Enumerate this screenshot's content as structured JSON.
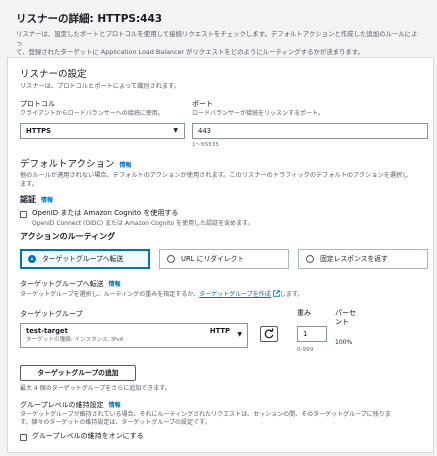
{
  "header": {
    "title": "リスナーの詳細: HTTPS:443",
    "desc_line1": "リスナーは、設定したポートとプロトコルを使用して接続リクエストをチェックします。デフォルトアクションと作成した追加のルールによっ",
    "desc_line2": "て、登録されたターゲットに Application Load Balancer がリクエストをどのようにルーティングするかが決まります。"
  },
  "listener_settings": {
    "title": "リスナーの設定",
    "desc": "リスナーは、プロトコルとポートによって識別されます。",
    "protocol_label": "プロトコル",
    "protocol_desc": "クライアントからロードバランサーへの接続に使用。",
    "protocol_value": "HTTPS",
    "port_label": "ポート",
    "port_desc": "ロードバランサーが接続をリッスンするポート。",
    "port_value": "443",
    "port_hint": "1〜65535"
  },
  "default_actions": {
    "title": "デフォルトアクション",
    "info": "情報",
    "desc": "他のルールが適用されない場合、デフォルトのアクションが使用されます。このリスナーのトラフィックのデフォルトのアクションを選択し",
    "desc2": "ます。"
  },
  "auth": {
    "title": "認証",
    "info": "情報",
    "checkbox_label": "OpenID または Amazon Cognito を使用する",
    "checkbox_desc": "OpenID Connect (OIDC) または Amazon Cognito を使用した認証を含めます。"
  },
  "routing": {
    "title": "アクションのルーティング",
    "options": [
      {
        "label": "ターゲットグループへ転送",
        "selected": true
      },
      {
        "label": "URL にリダイレクト",
        "selected": false
      },
      {
        "label": "固定レスポンスを返す",
        "selected": false
      }
    ]
  },
  "forward": {
    "title": "ターゲットグループへ転送",
    "info": "情報",
    "desc_prefix": "ターゲットグループを選択し、ルーティングの重みを指定するか、",
    "desc_link": "ターゲットグループを作成",
    "desc_suffix": "します。",
    "tg_label": "ターゲットグループ",
    "weight_label": "重み",
    "percent_label_1": "パーセ",
    "percent_label_2": "ント",
    "tg_name": "test-target",
    "tg_type": "ターゲットの種類: インスタンス, IPv4",
    "tg_protocol": "HTTP",
    "weight_value": "1",
    "weight_hint": "0-999",
    "percent_value": "100%",
    "add_button": "ターゲットグループの追加",
    "add_hint": "最大 4 個のターゲットグループをさらに追加できます。"
  },
  "stickiness": {
    "title": "グループレベルの維持設定",
    "info": "情報",
    "desc1": "ターゲットグループが維持されている場合、それにルーティングされたリクエストは、セッションの間、そのターゲットグループに残りま",
    "desc2": "す。個々のターゲットの維持設定は、ターゲットグループの設定です。",
    "checkbox_label": "グループレベルの維持をオンにする"
  },
  "colors": {
    "accent": "#0073bb",
    "border": "#879596",
    "muted": "#545b64"
  }
}
